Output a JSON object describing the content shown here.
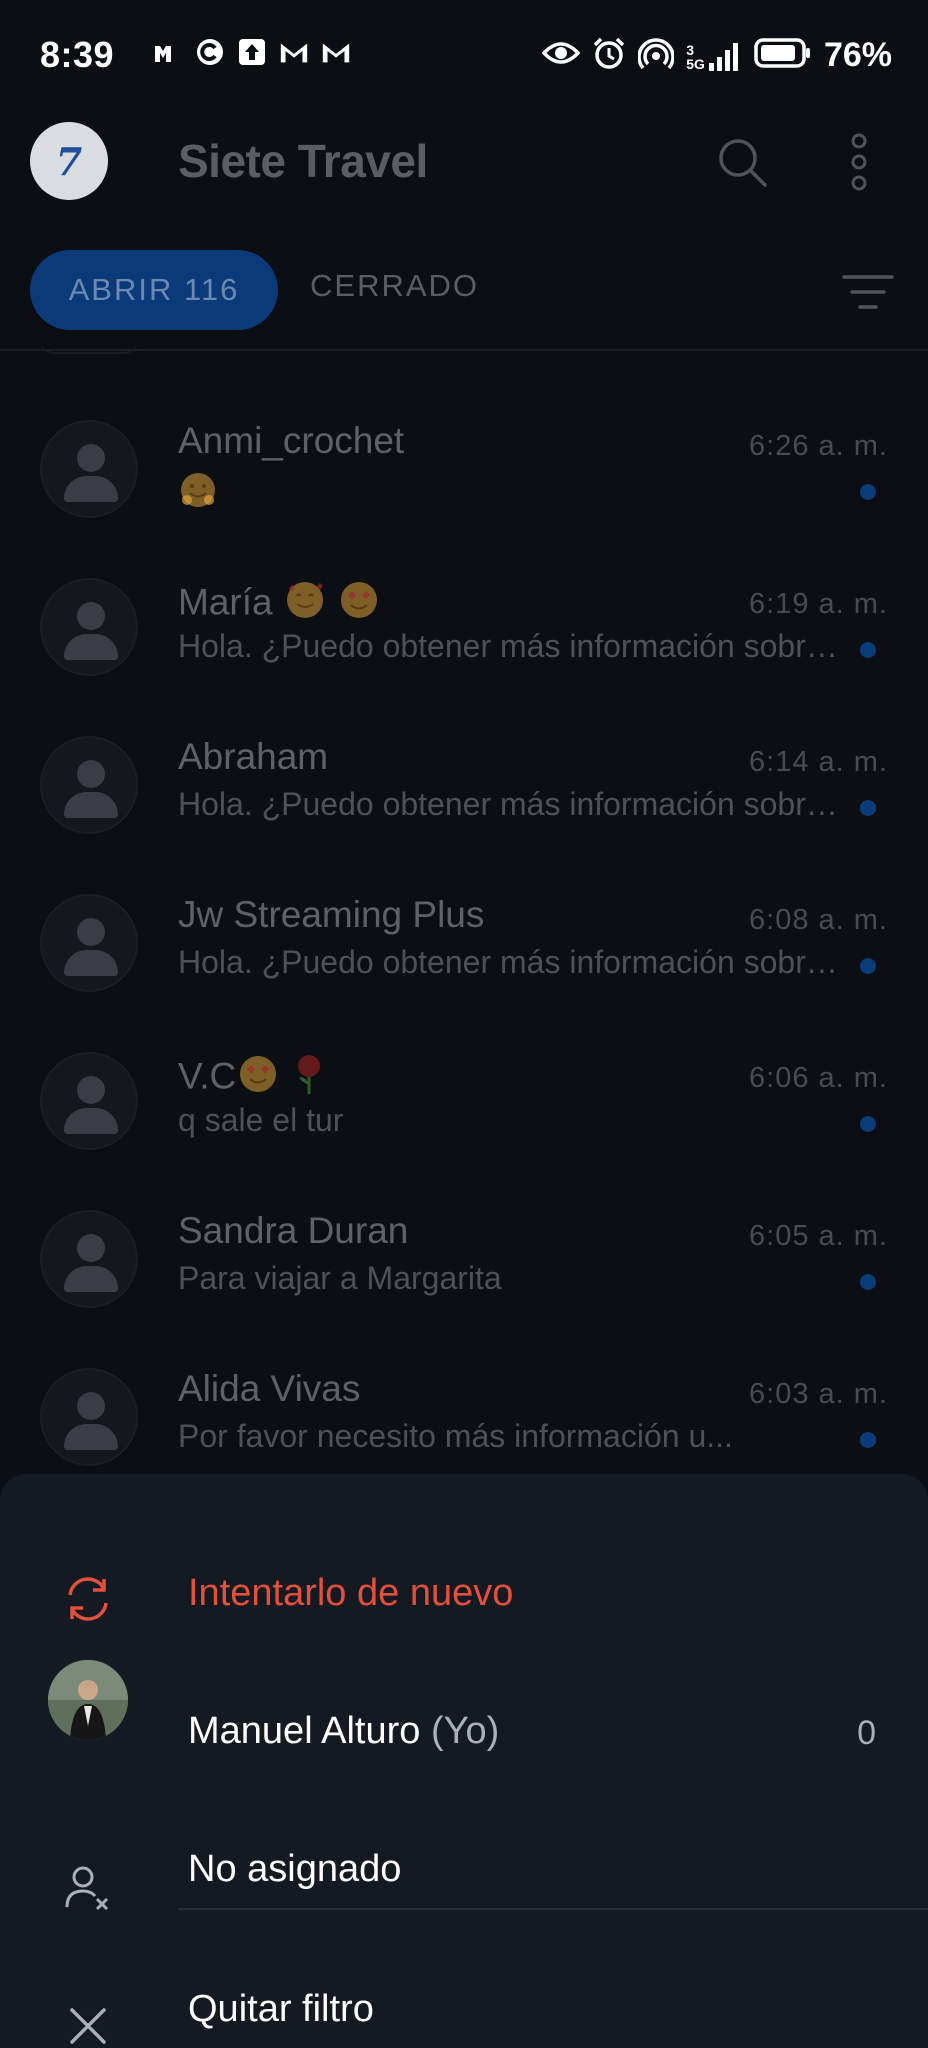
{
  "status_bar": {
    "time": "8:39",
    "network": "5G",
    "sim": "3",
    "battery_percent": "76%"
  },
  "header": {
    "logo_text": "7",
    "app_title": "Siete Travel"
  },
  "tabs": {
    "open_label": "ABRIR 116",
    "closed_label": "CERRADO"
  },
  "chats": [
    {
      "name": "Anmi_crochet",
      "name_emoji": [],
      "message": "",
      "message_emoji": [
        "hug"
      ],
      "time": "6:26 a. m.",
      "unread": true
    },
    {
      "name": "María",
      "name_emoji": [
        "smiling-hearts",
        "heart-eyes"
      ],
      "message": "Hola. ¿Puedo obtener más información sobre esto?",
      "message_emoji": [],
      "time": "6:19 a. m.",
      "unread": true
    },
    {
      "name": "Abraham",
      "name_emoji": [],
      "message": "Hola. ¿Puedo obtener más información sobre esto?",
      "message_emoji": [],
      "time": "6:14 a. m.",
      "unread": true
    },
    {
      "name": "Jw Streaming Plus",
      "name_emoji": [],
      "message": "Hola. ¿Puedo obtener más información sobre esto?",
      "message_emoji": [],
      "time": "6:08 a. m.",
      "unread": true
    },
    {
      "name": "V.C",
      "name_emoji": [
        "heart-eyes",
        "rose"
      ],
      "message": "q sale el tur",
      "message_emoji": [],
      "time": "6:06 a. m.",
      "unread": true
    },
    {
      "name": "Sandra Duran",
      "name_emoji": [],
      "message": "Para viajar a Margarita",
      "message_emoji": [],
      "time": "6:05 a. m.",
      "unread": true
    },
    {
      "name": "Alida Vivas",
      "name_emoji": [],
      "message": "Por favor necesito más información u...",
      "message_emoji": [],
      "time": "6:03 a. m.",
      "unread": true
    }
  ],
  "sheet": {
    "retry_label": "Intentarlo de nuevo",
    "user_name": "Manuel Alturo",
    "user_suffix": "(Yo)",
    "user_count": "0",
    "unassigned_label": "No asignado",
    "remove_filter_label": "Quitar filtro"
  },
  "colors": {
    "accent_tab": "#0a3a78",
    "retry": "#e1513b",
    "sheet_bg": "#141922",
    "unread_dot": "#0b3c7a"
  }
}
